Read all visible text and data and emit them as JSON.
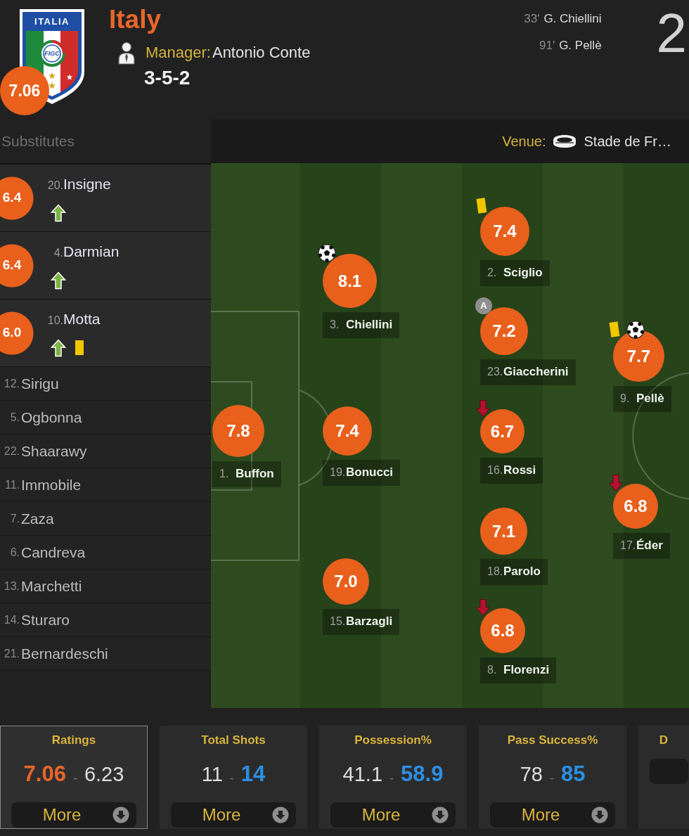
{
  "team": {
    "logo_title": "ITALIA",
    "logo_monogram": "FIGC",
    "rating": "7.06",
    "name": "Italy",
    "manager_label": "Manager:",
    "manager": "Antonio Conte",
    "formation": "3-5-2"
  },
  "goals": [
    {
      "minute": "33'",
      "player": "G. Chiellini"
    },
    {
      "minute": "91'",
      "player": "G. Pellè"
    }
  ],
  "score": "2",
  "substitutes": {
    "title": "Substitutes",
    "players": [
      {
        "kind": "used",
        "number": "20.",
        "name": "Insigne",
        "rating": "6.4",
        "events": [
          {
            "kind": "sub_on"
          }
        ]
      },
      {
        "kind": "used",
        "number": "4.",
        "name": "Darmian",
        "rating": "6.4",
        "events": [
          {
            "kind": "sub_on"
          }
        ]
      },
      {
        "kind": "used",
        "number": "10.",
        "name": "Motta",
        "rating": "6.0",
        "events": [
          {
            "kind": "sub_on"
          },
          {
            "kind": "yellow_card"
          }
        ]
      },
      {
        "kind": "unused",
        "number": "12.",
        "name": "Sirigu"
      },
      {
        "kind": "unused",
        "number": "5.",
        "name": "Ogbonna"
      },
      {
        "kind": "unused",
        "number": "22.",
        "name": "Shaarawy"
      },
      {
        "kind": "unused",
        "number": "11.",
        "name": "Immobile"
      },
      {
        "kind": "unused",
        "number": "7.",
        "name": "Zaza"
      },
      {
        "kind": "unused",
        "number": "6.",
        "name": "Candreva"
      },
      {
        "kind": "unused",
        "number": "13.",
        "name": "Marchetti"
      },
      {
        "kind": "unused",
        "number": "14.",
        "name": "Sturaro"
      },
      {
        "kind": "unused",
        "number": "21.",
        "name": "Bernardeschi"
      }
    ]
  },
  "venue": {
    "label": "Venue:",
    "name": "Stade de Fr…"
  },
  "pitch": {
    "lines": [
      {
        "players": [
          {
            "number": "1.",
            "name": "Buffon",
            "rating": "7.8"
          }
        ]
      },
      {
        "players": [
          {
            "number": "3.",
            "name": "Chiellini",
            "rating": "8.1",
            "events": [
              {
                "kind": "goal"
              }
            ]
          },
          {
            "number": "19.",
            "name": "Bonucci",
            "rating": "7.4"
          },
          {
            "number": "15.",
            "name": "Barzagli",
            "rating": "7.0"
          }
        ]
      },
      {
        "players": [
          {
            "number": "2.",
            "name": "Sciglio",
            "rating": "7.4",
            "events": [
              {
                "kind": "yellow_card"
              }
            ]
          },
          {
            "number": "23.",
            "name": "Giaccherini",
            "rating": "7.2",
            "events": [
              {
                "kind": "badge",
                "text": "A"
              }
            ]
          },
          {
            "number": "16.",
            "name": "Rossi",
            "rating": "6.7",
            "events": [
              {
                "kind": "sub_off"
              }
            ]
          },
          {
            "number": "18.",
            "name": "Parolo",
            "rating": "7.1"
          },
          {
            "number": "8.",
            "name": "Florenzi",
            "rating": "6.8",
            "events": [
              {
                "kind": "sub_off"
              }
            ]
          }
        ]
      },
      {
        "players": [
          {
            "number": "9.",
            "name": "Pellè",
            "rating": "7.7",
            "events": [
              {
                "kind": "yellow_card"
              },
              {
                "kind": "goal"
              }
            ]
          },
          {
            "number": "17.",
            "name": "Éder",
            "rating": "6.8",
            "events": [
              {
                "kind": "sub_off"
              }
            ]
          }
        ]
      }
    ]
  },
  "stats": [
    {
      "title": "Ratings",
      "selected": true,
      "cut": false,
      "home": {
        "value": "7.06",
        "lead": true
      },
      "separator": "-",
      "away": {
        "value": "6.23",
        "lead": false
      },
      "button": "More"
    },
    {
      "title": "Total Shots",
      "selected": false,
      "cut": false,
      "home": {
        "value": "11",
        "lead": false
      },
      "separator": "-",
      "away": {
        "value": "14",
        "lead": true
      },
      "button": "More"
    },
    {
      "title": "Possession%",
      "selected": false,
      "cut": false,
      "home": {
        "value": "41.1",
        "lead": false
      },
      "separator": "-",
      "away": {
        "value": "58.9",
        "lead": true
      },
      "button": "More"
    },
    {
      "title": "Pass Success%",
      "selected": false,
      "cut": false,
      "home": {
        "value": "78",
        "lead": false
      },
      "separator": "-",
      "away": {
        "value": "85",
        "lead": true
      },
      "button": "More"
    },
    {
      "title": "D",
      "selected": false,
      "cut": true
    }
  ]
}
